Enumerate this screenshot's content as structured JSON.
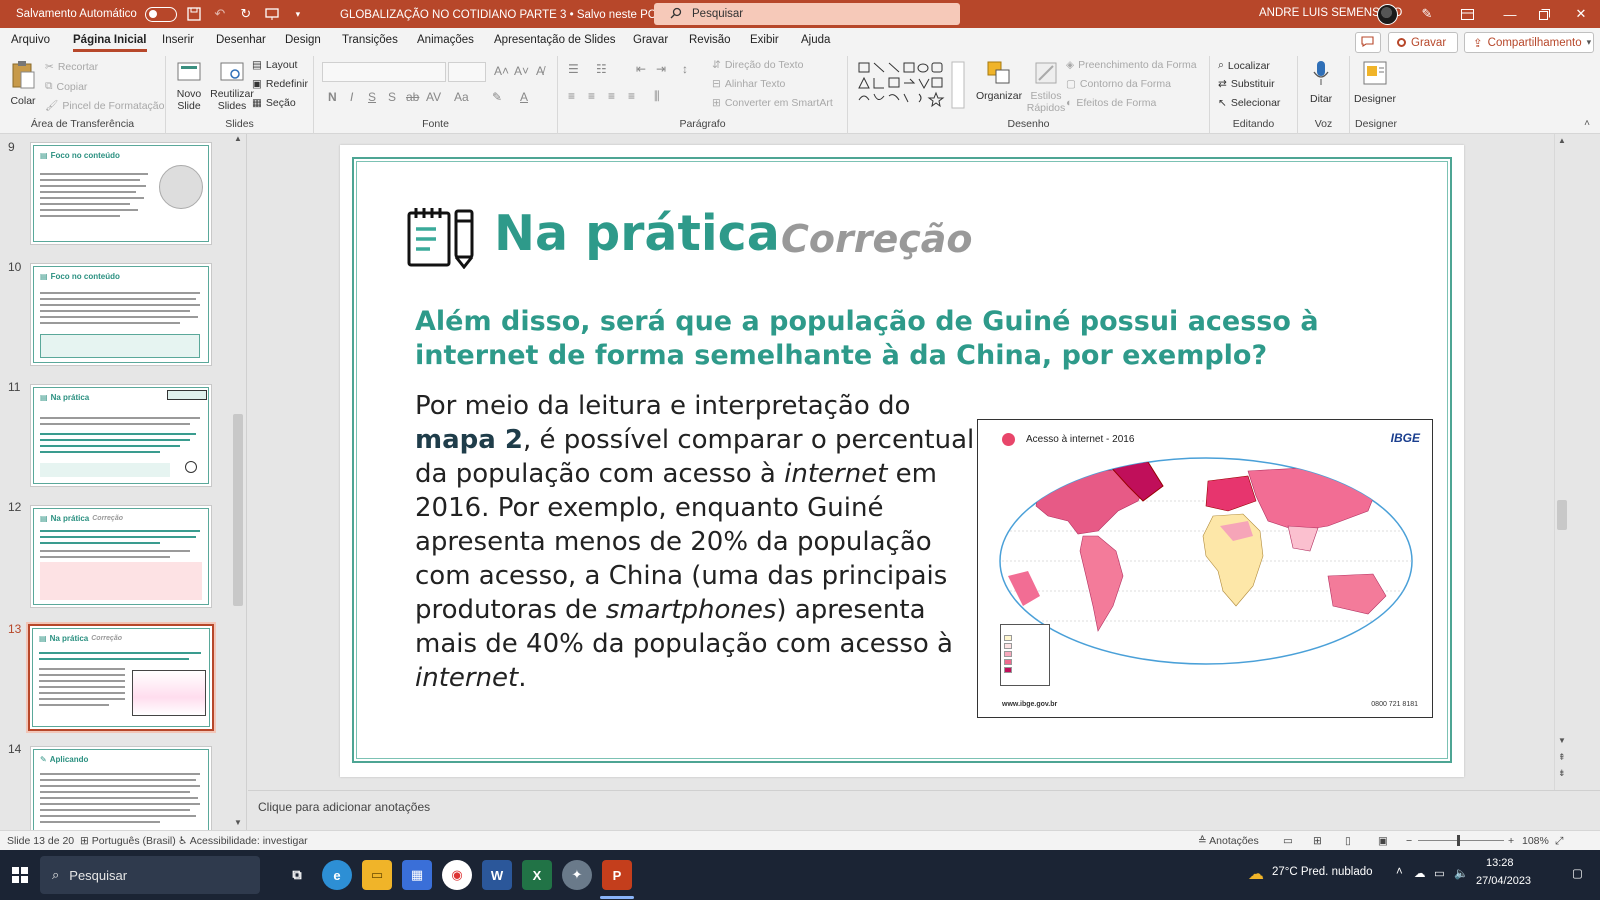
{
  "titlebar": {
    "autosave_label": "Salvamento Automático",
    "document": "GLOBALIZAÇÃO NO COTIDIANO PARTE 3 • Salvo neste PC",
    "search_placeholder": "Pesquisar",
    "user": "ANDRE LUIS SEMENSATO"
  },
  "menu": {
    "tabs": [
      "Arquivo",
      "Página Inicial",
      "Inserir",
      "Desenhar",
      "Design",
      "Transições",
      "Animações",
      "Apresentação de Slides",
      "Gravar",
      "Revisão",
      "Exibir",
      "Ajuda"
    ],
    "record_label": "Gravar",
    "share_label": "Compartilhamento"
  },
  "ribbon": {
    "clipboard": {
      "label": "Área de Transferência",
      "paste": "Colar",
      "cut": "Recortar",
      "copy": "Copiar",
      "painter": "Pincel de Formatação"
    },
    "slides": {
      "label": "Slides",
      "new_slide": "Novo Slide",
      "reuse": "Reutilizar Slides",
      "layout": "Layout",
      "reset": "Redefinir",
      "section": "Seção"
    },
    "font": {
      "label": "Fonte"
    },
    "paragraph": {
      "label": "Parágrafo",
      "text_direction": "Direção do Texto",
      "align_text": "Alinhar Texto",
      "smartart": "Converter em SmartArt"
    },
    "drawing": {
      "label": "Desenho",
      "arrange": "Organizar",
      "styles": "Estilos Rápidos",
      "fill": "Preenchimento da Forma",
      "outline": "Contorno da Forma",
      "effects": "Efeitos de Forma"
    },
    "editing": {
      "label": "Editando",
      "find": "Localizar",
      "replace": "Substituir",
      "select": "Selecionar"
    },
    "voice": {
      "label": "Voz",
      "dictate": "Ditar"
    },
    "designer": {
      "label": "Designer",
      "designer": "Designer"
    }
  },
  "slides": [
    {
      "num": "9",
      "title": "Foco no conteúdo",
      "subtitle": ""
    },
    {
      "num": "10",
      "title": "Foco no conteúdo",
      "subtitle": ""
    },
    {
      "num": "11",
      "title": "Na prática",
      "subtitle": ""
    },
    {
      "num": "12",
      "title": "Na prática",
      "subtitle": "Correção"
    },
    {
      "num": "13",
      "title": "Na prática",
      "subtitle": "Correção"
    },
    {
      "num": "14",
      "title": "Aplicando",
      "subtitle": ""
    }
  ],
  "slide": {
    "title": "Na prática",
    "subtitle": "Correção",
    "question": "Além disso, será que a população de Guiné possui acesso à internet de forma semelhante à da China, por exemplo?",
    "body": {
      "p1": "Por meio da leitura e interpretação do ",
      "bold": "mapa 2",
      "p2": ", é possível comparar o percentual da população com acesso à ",
      "i1": "internet",
      "p3": " em 2016. Por exemplo, enquanto Guiné apresenta menos de 20% da população com acesso, a China (uma das principais produtoras de ",
      "i2": "smartphones",
      "p4": ") apresenta mais de 40% da população com acesso à ",
      "i3": "internet",
      "p5": "."
    },
    "map": {
      "title": "Acesso à internet - 2016",
      "logo": "IBGE",
      "url": "www.ibge.gov.br",
      "phone": "0800 721 8181"
    }
  },
  "notes_placeholder": "Clique para adicionar anotações",
  "status": {
    "slide_count": "Slide 13 de 20",
    "language": "Português (Brasil)",
    "accessibility": "Acessibilidade: investigar",
    "notes": "Anotações",
    "zoom": "108%"
  },
  "taskbar": {
    "search": "Pesquisar",
    "weather": "27°C  Pred. nublado",
    "time": "13:28",
    "date": "27/04/2023"
  },
  "colors": {
    "accent": "#b7472a",
    "teal": "#2e9a8a"
  }
}
